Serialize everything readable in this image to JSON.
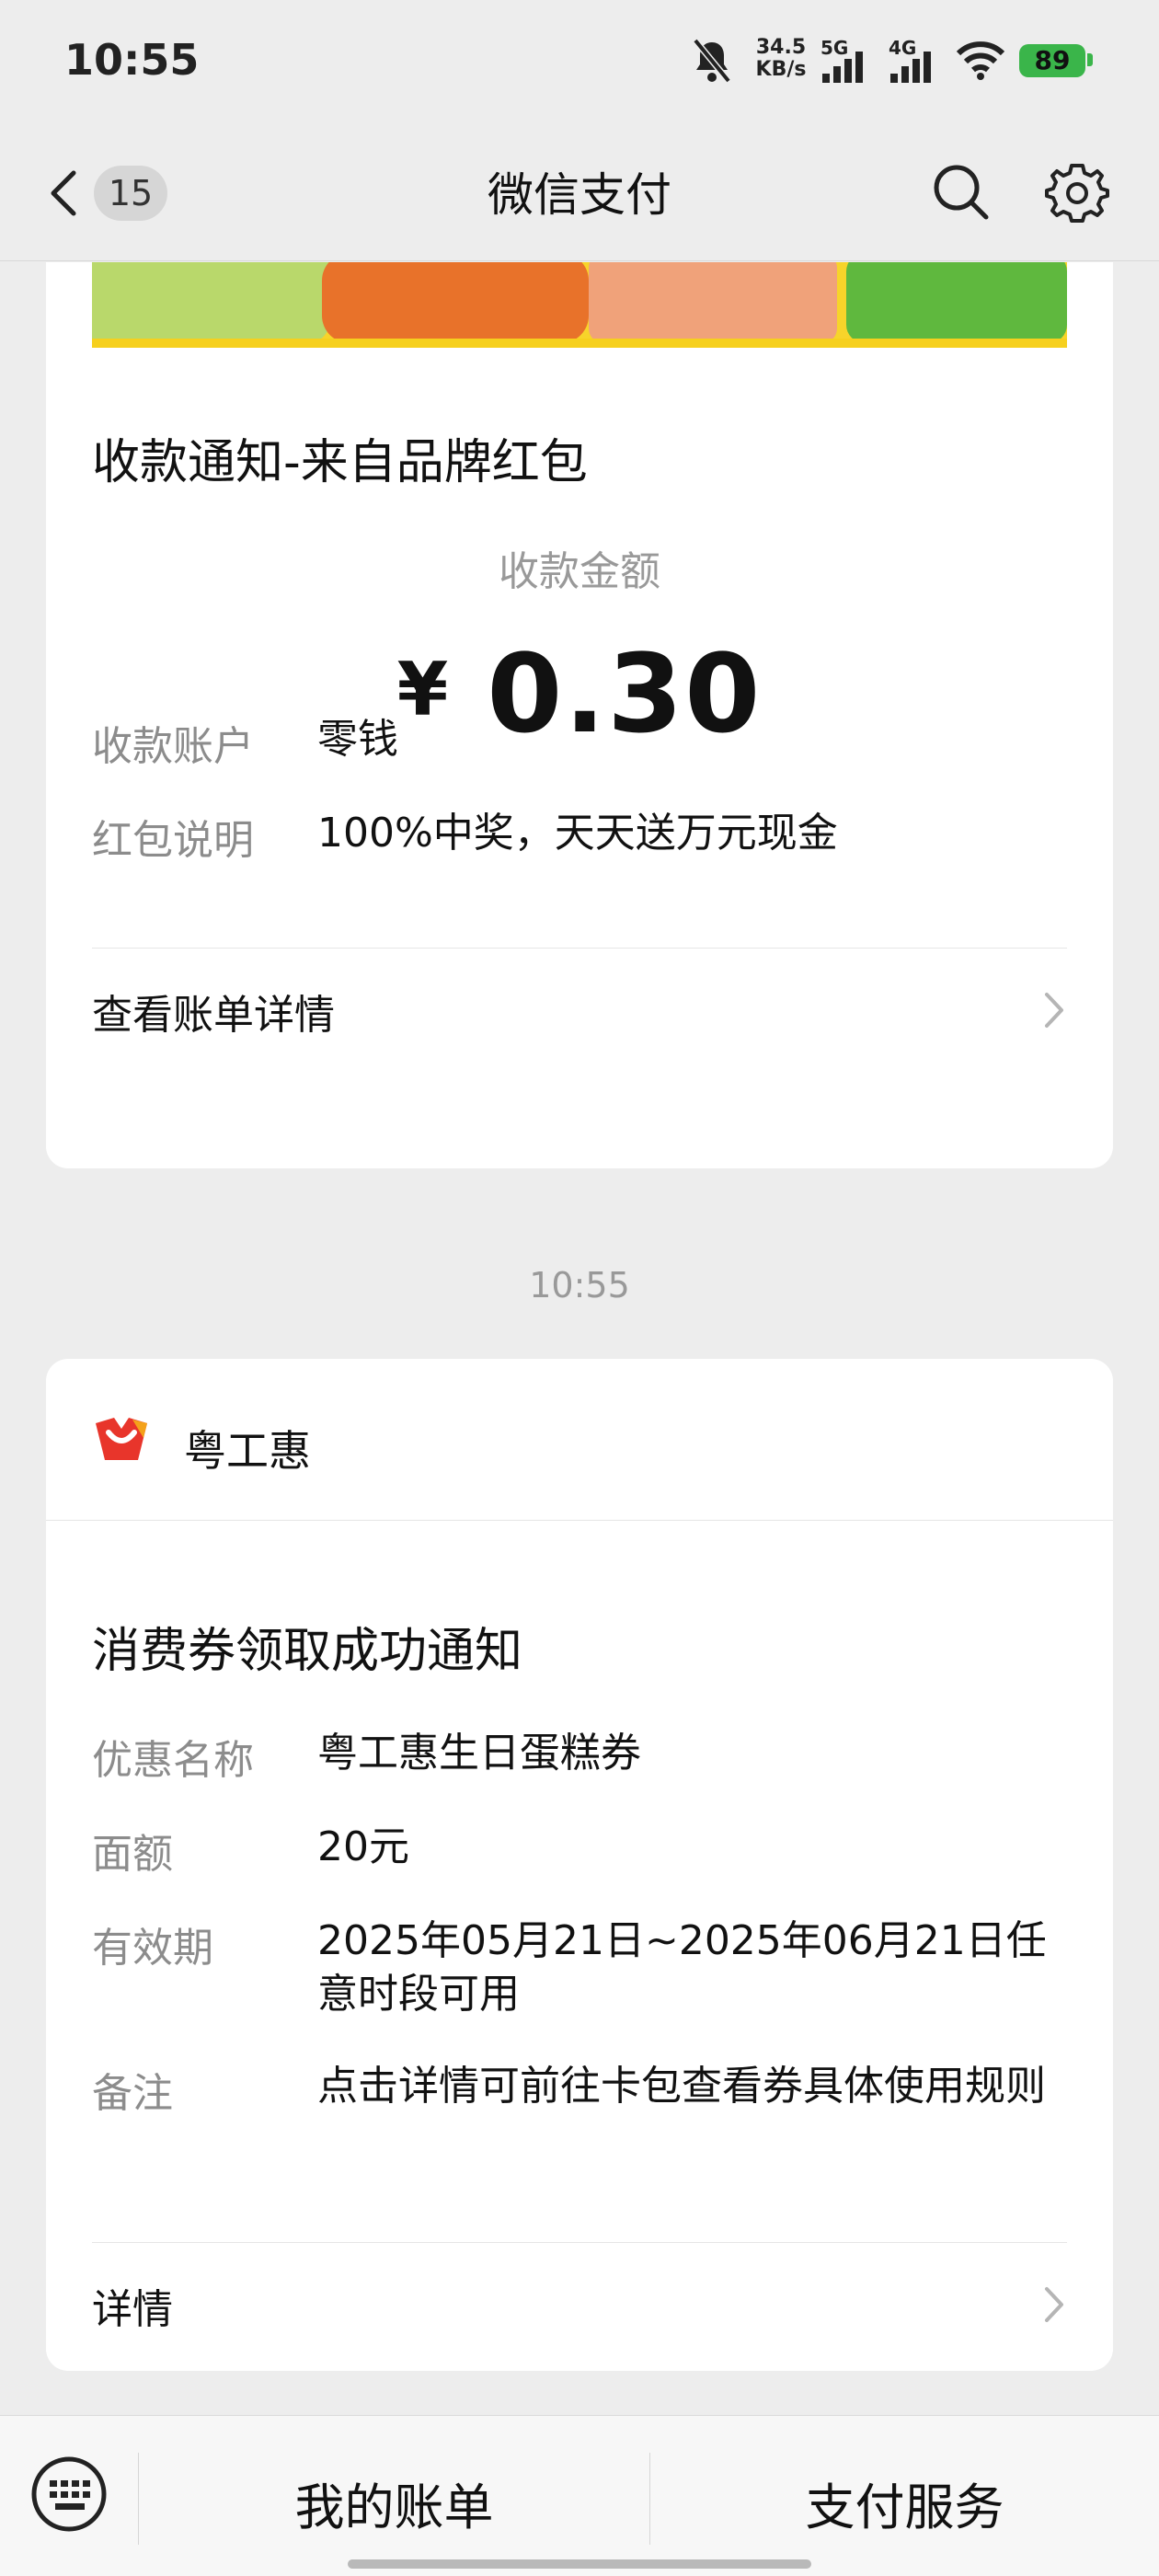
{
  "status_bar": {
    "time": "10:55",
    "net_speed_value": "34.5",
    "net_speed_unit": "KB/s",
    "signal1": "5G",
    "signal2": "4G",
    "battery": "89",
    "icons": [
      "bell-mute-icon",
      "signal-icon",
      "signal-icon",
      "wifi-icon",
      "battery-icon"
    ]
  },
  "nav": {
    "title": "微信支付",
    "unread_count": "15",
    "icons": [
      "back-icon",
      "search-icon",
      "settings-icon"
    ]
  },
  "card1": {
    "title": "收款通知-来自品牌红包",
    "amount_label": "收款金额",
    "currency": "¥",
    "amount": "0.30",
    "rows": [
      {
        "key": "收款账户",
        "value": "零钱"
      },
      {
        "key": "红包说明",
        "value": "100%中奖，天天送万元现金"
      }
    ],
    "link": "查看账单详情"
  },
  "timestamp": "10:55",
  "card2": {
    "brand": "粤工惠",
    "title": "消费券领取成功通知",
    "rows": [
      {
        "key": "优惠名称",
        "value": "粤工惠生日蛋糕券"
      },
      {
        "key": "面额",
        "value": "20元"
      },
      {
        "key": "有效期",
        "value": "2025年05月21日~2025年06月21日任意时段可用"
      },
      {
        "key": "备注",
        "value": "点击详情可前往卡包查看券具体使用规则"
      }
    ],
    "link": "详情"
  },
  "bottom_bar": {
    "tab1": "我的账单",
    "tab2": "支付服务"
  },
  "colors": {
    "background": "#ededed",
    "card": "#ffffff",
    "battery": "#3ab54a",
    "brand_red": "#e8352b"
  }
}
